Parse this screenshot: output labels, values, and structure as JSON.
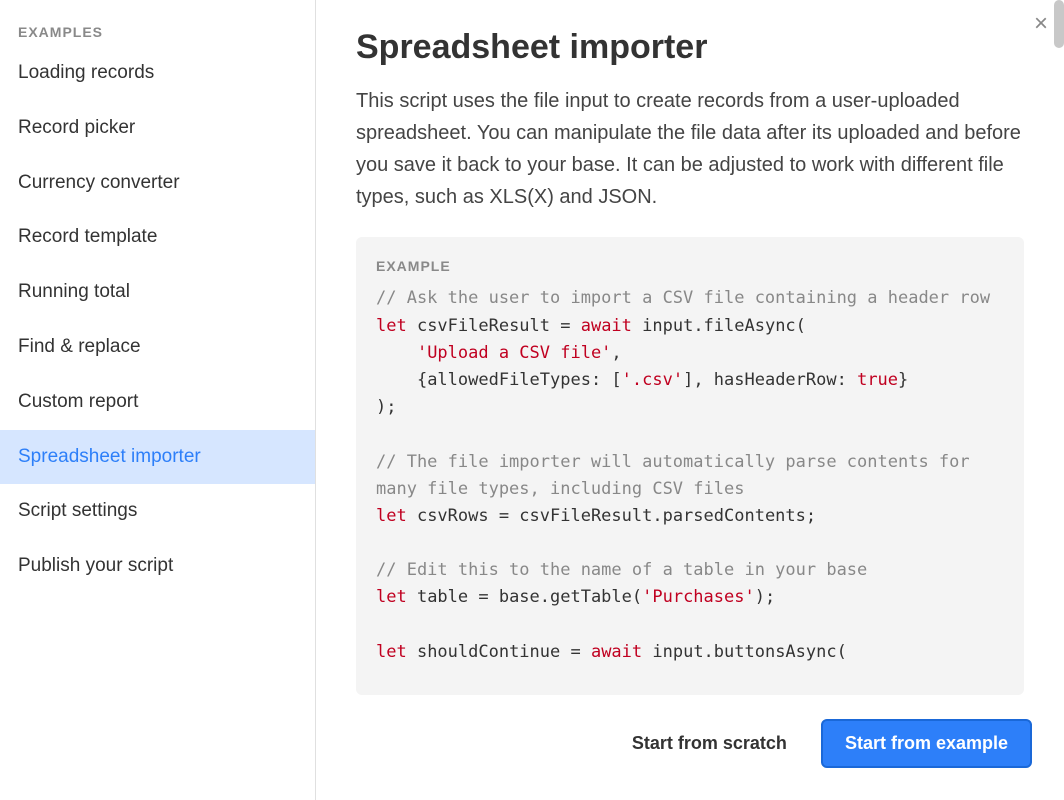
{
  "sidebar": {
    "header": "EXAMPLES",
    "items": [
      {
        "label": "Loading records",
        "selected": false
      },
      {
        "label": "Record picker",
        "selected": false
      },
      {
        "label": "Currency converter",
        "selected": false
      },
      {
        "label": "Record template",
        "selected": false
      },
      {
        "label": "Running total",
        "selected": false
      },
      {
        "label": "Find & replace",
        "selected": false
      },
      {
        "label": "Custom report",
        "selected": false
      },
      {
        "label": "Spreadsheet importer",
        "selected": true
      },
      {
        "label": "Script settings",
        "selected": false
      },
      {
        "label": "Publish your script",
        "selected": false
      }
    ]
  },
  "main": {
    "title": "Spreadsheet importer",
    "description": "This script uses the file input to create records from a user-uploaded spreadsheet. You can manipulate the file data after its uploaded and before you save it back to your base. It can be adjusted to work with different file types, such as XLS(X) and JSON.",
    "code_label": "EXAMPLE",
    "code": {
      "tokens": [
        {
          "t": "comment",
          "v": "// Ask the user to import a CSV file containing a header row"
        },
        {
          "t": "nl"
        },
        {
          "t": "keyword",
          "v": "let"
        },
        {
          "t": "plain",
          "v": " csvFileResult = "
        },
        {
          "t": "await",
          "v": "await"
        },
        {
          "t": "plain",
          "v": " input.fileAsync("
        },
        {
          "t": "nl"
        },
        {
          "t": "plain",
          "v": "    "
        },
        {
          "t": "string",
          "v": "'Upload a CSV file'"
        },
        {
          "t": "plain",
          "v": ","
        },
        {
          "t": "nl"
        },
        {
          "t": "plain",
          "v": "    {allowedFileTypes: ["
        },
        {
          "t": "string",
          "v": "'.csv'"
        },
        {
          "t": "plain",
          "v": "], hasHeaderRow: "
        },
        {
          "t": "bool",
          "v": "true"
        },
        {
          "t": "plain",
          "v": "}"
        },
        {
          "t": "nl"
        },
        {
          "t": "plain",
          "v": ");"
        },
        {
          "t": "nl"
        },
        {
          "t": "nl"
        },
        {
          "t": "comment",
          "v": "// The file importer will automatically parse contents for many file types, including CSV files"
        },
        {
          "t": "nl"
        },
        {
          "t": "keyword",
          "v": "let"
        },
        {
          "t": "plain",
          "v": " csvRows = csvFileResult.parsedContents;"
        },
        {
          "t": "nl"
        },
        {
          "t": "nl"
        },
        {
          "t": "comment",
          "v": "// Edit this to the name of a table in your base"
        },
        {
          "t": "nl"
        },
        {
          "t": "keyword",
          "v": "let"
        },
        {
          "t": "plain",
          "v": " table = base.getTable("
        },
        {
          "t": "string",
          "v": "'Purchases'"
        },
        {
          "t": "plain",
          "v": ");"
        },
        {
          "t": "nl"
        },
        {
          "t": "nl"
        },
        {
          "t": "keyword",
          "v": "let"
        },
        {
          "t": "plain",
          "v": " shouldContinue = "
        },
        {
          "t": "await",
          "v": "await"
        },
        {
          "t": "plain",
          "v": " input.buttonsAsync("
        }
      ]
    }
  },
  "footer": {
    "secondary_label": "Start from scratch",
    "primary_label": "Start from example"
  }
}
